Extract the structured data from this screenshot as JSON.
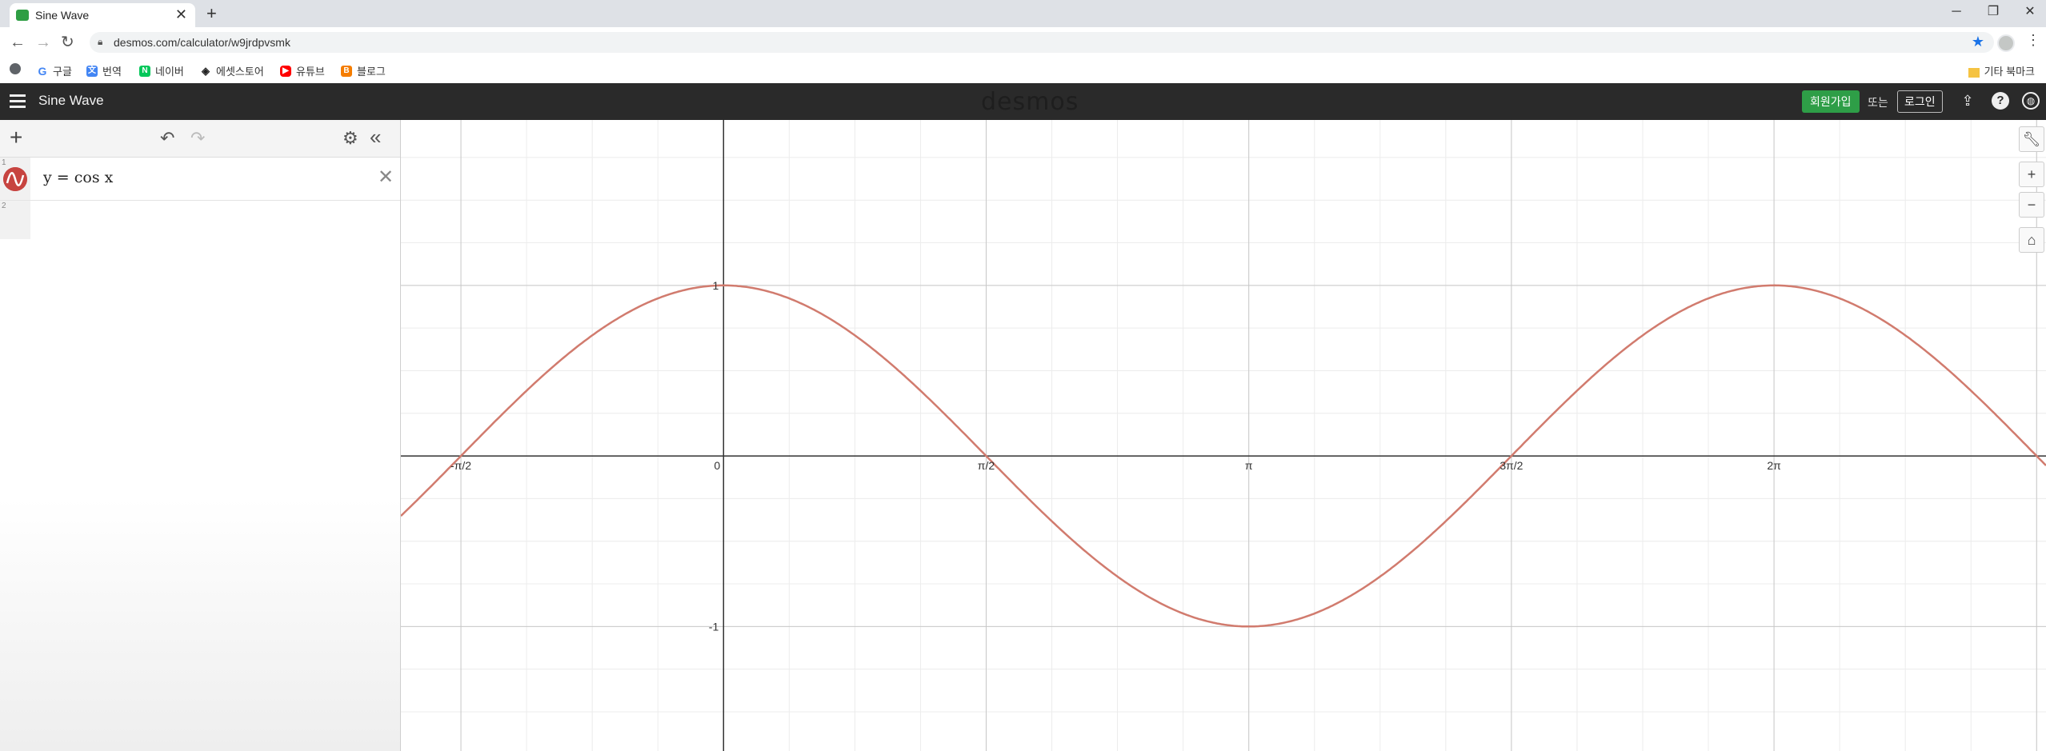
{
  "browser": {
    "tab_title": "Sine Wave",
    "tab_close": "✕",
    "new_tab": "+",
    "url": "desmos.com/calculator/w9jrdpvsmk",
    "window_controls": [
      "─",
      "❐",
      "✕"
    ],
    "bookmarks": [
      {
        "label": "",
        "icon": "apps-icon",
        "color": "#5f6368"
      },
      {
        "label": "구글",
        "icon": "google-icon",
        "color": "#4285f4"
      },
      {
        "label": "번역",
        "icon": "translate-icon",
        "color": "#4285f4"
      },
      {
        "label": "네이버",
        "icon": "naver-icon",
        "color": "#03c75a"
      },
      {
        "label": "에셋스토어",
        "icon": "unity-icon",
        "color": "#222222"
      },
      {
        "label": "유튜브",
        "icon": "youtube-icon",
        "color": "#ff0000"
      },
      {
        "label": "블로그",
        "icon": "blogger-icon",
        "color": "#f57d00"
      }
    ],
    "other_bookmarks": "기타 북마크"
  },
  "header": {
    "title": "Sine Wave",
    "logo": "desmos",
    "signup": "회원가입",
    "or": "또는",
    "login": "로그인"
  },
  "expressions": [
    {
      "number": "1",
      "latex_display": "y = cos x",
      "color": "#c74440"
    },
    {
      "number": "2",
      "latex_display": ""
    }
  ],
  "graph": {
    "curve_color": "#d17b6e",
    "x_ticks": [
      {
        "label": "-π/2",
        "value": -1.5708
      },
      {
        "label": "0",
        "value": 0
      },
      {
        "label": "π/2",
        "value": 1.5708
      },
      {
        "label": "π",
        "value": 3.1416
      },
      {
        "label": "3π/2",
        "value": 4.7124
      },
      {
        "label": "2π",
        "value": 6.2832
      }
    ],
    "y_ticks": [
      {
        "label": "1",
        "value": 1
      },
      {
        "label": "-1",
        "value": -1
      }
    ],
    "x_range": [
      -1.93,
      7.91
    ],
    "y_range": [
      -1.73,
      1.97
    ]
  },
  "chart_data": {
    "type": "line",
    "title": "",
    "xlabel": "",
    "ylabel": "",
    "xlim": [
      -1.93,
      7.91
    ],
    "ylim": [
      -1.73,
      1.97
    ],
    "grid": true,
    "series": [
      {
        "name": "y = cos x",
        "function": "cos",
        "x": [
          -1.93,
          -1.5708,
          -0.7854,
          0,
          0.7854,
          1.5708,
          2.3562,
          3.1416,
          3.927,
          4.7124,
          5.4978,
          6.2832,
          7.0686,
          7.854
        ],
        "y": [
          -0.35,
          0,
          0.707,
          1,
          0.707,
          0,
          -0.707,
          -1,
          -0.707,
          0,
          0.707,
          1,
          0.707,
          0
        ]
      }
    ]
  }
}
